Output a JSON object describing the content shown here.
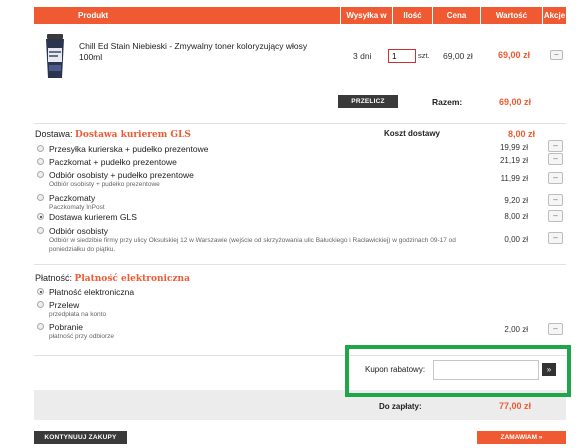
{
  "table_header": {
    "produkt": "Produkt",
    "wysylka": "Wysyłka w",
    "ilosc": "Ilość",
    "cena": "Cena",
    "wartosc": "Wartość",
    "akcje": "Akcje"
  },
  "product": {
    "name": "Chill Ed Stain Niebieski - Zmywalny toner koloryzujący włosy 100ml",
    "shipping_days": "3 dni",
    "quantity": "1",
    "unit": "szt.",
    "price": "69,00 zł",
    "value": "69,00 zł",
    "remove_label": "–"
  },
  "recalc_button": "PRZELICZ",
  "subtotal": {
    "label": "Razem:",
    "value": "69,00 zł"
  },
  "delivery": {
    "label": "Dostawa:",
    "selected": "Dostawa kurierem GLS",
    "cost_label": "Koszt dostawy",
    "cost_value": "8,00 zł",
    "options": [
      {
        "label": "Przesyłka kurierska + pudełko prezentowe",
        "sub": "",
        "price": "19,99 zł",
        "selected": false
      },
      {
        "label": "Paczkomat + pudełko prezentowe",
        "sub": "",
        "price": "21,19 zł",
        "selected": false
      },
      {
        "label": "Odbiór osobisty + pudełko prezentowe",
        "sub": "Odbiór osobisty + pudełko prezentowe",
        "price": "11,99 zł",
        "selected": false
      },
      {
        "label": "Paczkomaty",
        "sub": "Paczkomaty InPost",
        "price": "9,20 zł",
        "selected": false
      },
      {
        "label": "Dostawa kurierem GLS",
        "sub": "",
        "price": "8,00 zł",
        "selected": true
      },
      {
        "label": "Odbiór osobisty",
        "sub": "Odbiór w siedzibie firmy przy ulicy Oksulskiej 12 w Warszawie (wejście od skrzyżowania ulic Bałuckiego i Racławickiej) w godzinach 09-17 od poniedziałku do piątku.",
        "price": "0,00 zł",
        "selected": false
      }
    ]
  },
  "payment": {
    "label": "Płatność:",
    "selected": "Płatność elektroniczna",
    "options": [
      {
        "label": "Płatność elektroniczna",
        "sub": "",
        "price": "",
        "selected": true
      },
      {
        "label": "Przelew",
        "sub": "przedpłata na konto",
        "price": "",
        "selected": false
      },
      {
        "label": "Pobranie",
        "sub": "płatność przy odbiorze",
        "price": "2,00 zł",
        "selected": false
      }
    ]
  },
  "coupon": {
    "label": "Kupon rabatowy:",
    "value": "",
    "submit": "»"
  },
  "total": {
    "label": "Do zapłaty:",
    "value": "77,00 zł"
  },
  "continue_button": "KONTYNUUJ ZAKUPY",
  "order_button": "ZAMAWIAM »",
  "colors": {
    "accent": "#f05a33",
    "highlight_box": "#20a54b",
    "dark_button": "#3a3a3a"
  }
}
